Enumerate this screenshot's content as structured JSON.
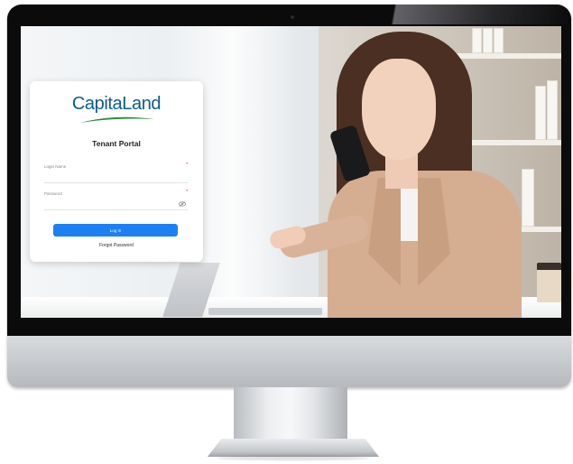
{
  "brand": {
    "name": "CapitaLand",
    "logo_color": "#0d5b89",
    "swoosh_color": "#2e8b3e"
  },
  "portal": {
    "title": "Tenant Portal"
  },
  "form": {
    "login_name": {
      "label": "Login Name",
      "value": "",
      "required_mark": "*"
    },
    "password": {
      "label": "Password",
      "value": "",
      "required_mark": "*",
      "toggle_icon": "eye-icon"
    },
    "submit_label": "Log In",
    "forgot_label": "Forgot Password"
  },
  "colors": {
    "primary_button": "#1d80f2",
    "required": "#e0483f"
  }
}
